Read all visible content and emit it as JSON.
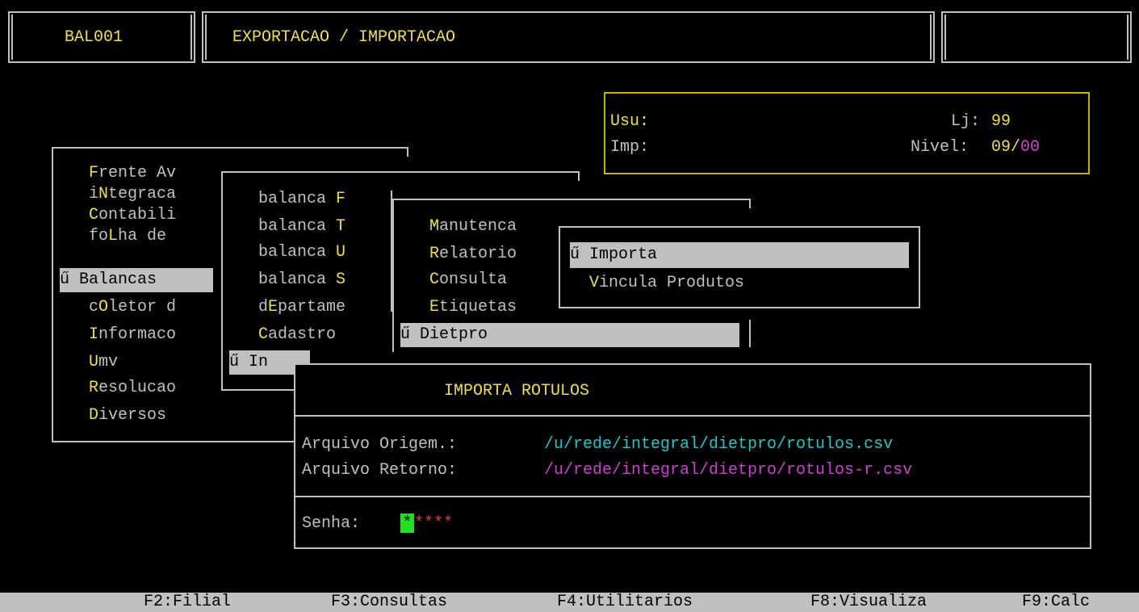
{
  "header": {
    "program_code": "BAL001",
    "title": "EXPORTACAO / IMPORTACAO"
  },
  "user_info": {
    "usu_label": "Usu:",
    "imp_label": "Imp:",
    "lj_label": "Lj:",
    "lj_value": "99",
    "nivel_label": "Nivel:",
    "nivel_value_a": "09",
    "nivel_sep": "/",
    "nivel_value_b": "00"
  },
  "menu1": {
    "items": [
      {
        "hotkey_pre": "",
        "hotkey": "F",
        "rest": "rente Av"
      },
      {
        "hotkey_pre": "i",
        "hotkey": "N",
        "rest": "tegraca"
      },
      {
        "hotkey_pre": "",
        "hotkey": "C",
        "rest": "ontabili"
      },
      {
        "hotkey_pre": "fo",
        "hotkey": "L",
        "rest": "ha de"
      },
      {
        "hotkey_pre": "ű ",
        "hotkey": "B",
        "rest": "alancas"
      },
      {
        "hotkey_pre": "c",
        "hotkey": "O",
        "rest": "letor d"
      },
      {
        "hotkey_pre": "",
        "hotkey": "I",
        "rest": "nformaco"
      },
      {
        "hotkey_pre": "",
        "hotkey": "U",
        "rest": "mv"
      },
      {
        "hotkey_pre": "",
        "hotkey": "R",
        "rest": "esolucao"
      },
      {
        "hotkey_pre": "",
        "hotkey": "D",
        "rest": "iversos"
      }
    ]
  },
  "menu2": {
    "items": [
      {
        "hotkey_pre": "balanca ",
        "hotkey": "F",
        "rest": ""
      },
      {
        "hotkey_pre": "balanca ",
        "hotkey": "T",
        "rest": ""
      },
      {
        "hotkey_pre": "balanca ",
        "hotkey": "U",
        "rest": ""
      },
      {
        "hotkey_pre": "balanca ",
        "hotkey": "S",
        "rest": ""
      },
      {
        "hotkey_pre": "d",
        "hotkey": "E",
        "rest": "partame"
      },
      {
        "hotkey_pre": "",
        "hotkey": "C",
        "rest": "adastro"
      },
      {
        "hotkey_pre": "ű ",
        "hotkey": "I",
        "rest": "n"
      }
    ]
  },
  "menu3": {
    "items": [
      {
        "hotkey_pre": "",
        "hotkey": "M",
        "rest": "anutenca"
      },
      {
        "hotkey_pre": "",
        "hotkey": "R",
        "rest": "elatorio"
      },
      {
        "hotkey_pre": "",
        "hotkey": "C",
        "rest": "onsulta"
      },
      {
        "hotkey_pre": "",
        "hotkey": "E",
        "rest": "tiquetas"
      },
      {
        "hotkey_pre": "ű ",
        "hotkey": "D",
        "rest": "ietpro"
      }
    ]
  },
  "menu4": {
    "items": [
      {
        "hotkey_pre": "ű ",
        "hotkey": "I",
        "rest": "mporta"
      },
      {
        "hotkey_pre": "  ",
        "hotkey": "V",
        "rest": "incula Produtos"
      }
    ]
  },
  "dialog": {
    "title": "IMPORTA ROTULOS",
    "origem_label": "Arquivo Origem.:",
    "origem_value": "/u/rede/integral/dietpro/rotulos.csv",
    "retorno_label": "Arquivo Retorno:",
    "retorno_value": "/u/rede/integral/dietpro/rotulos-r.csv",
    "senha_label": "Senha:",
    "senha_cursor": "*",
    "senha_value": "****"
  },
  "status_bar": {
    "f2": "F2:Filial",
    "f3": "F3:Consultas",
    "f4": "F4:Utilitarios",
    "f8": "F8:Visualiza",
    "f9": "F9:Calc"
  },
  "colors": {
    "background": "#000000",
    "text": "#c0c0c0",
    "hotkey": "#f0e040",
    "cyan": "#20c8c8",
    "magenta": "#d040d0",
    "cursor": "#20e020"
  }
}
